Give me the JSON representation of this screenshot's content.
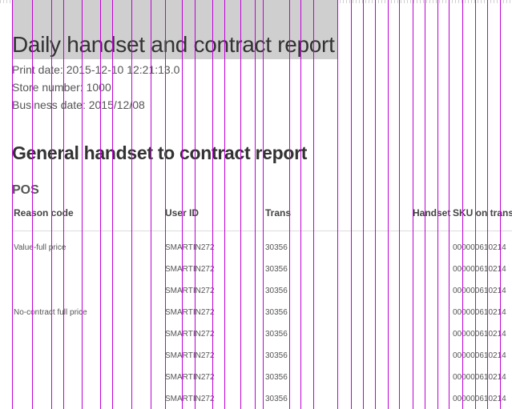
{
  "report": {
    "title": "Daily handset and contract report",
    "print_date": "Print date: 2015-12-10 12:21:13.0",
    "store_number": "Store number: 1000",
    "business_date": "Business date: 2015/12/08"
  },
  "section": {
    "title": "General handset to contract report",
    "subtitle": "POS"
  },
  "table": {
    "columns": [
      "Reason code",
      "User ID",
      "Trans",
      "Handset",
      "SKU on trans"
    ],
    "rows": [
      {
        "reason": "Value-full price",
        "user": "SMARTIN272",
        "trans": "30356",
        "sku": "000000610214"
      },
      {
        "reason": "",
        "user": "SMARTIN272",
        "trans": "30356",
        "sku": "000000610214"
      },
      {
        "reason": "",
        "user": "SMARTIN272",
        "trans": "30356",
        "sku": "000000610214"
      },
      {
        "reason": "No-contract full price",
        "user": "SMARTIN272",
        "trans": "30356",
        "sku": "000000610214"
      },
      {
        "reason": "",
        "user": "SMARTIN272",
        "trans": "30356",
        "sku": "000000610214"
      },
      {
        "reason": "",
        "user": "SMARTIN272",
        "trans": "30356",
        "sku": "000000610214"
      },
      {
        "reason": "",
        "user": "SMARTIN272",
        "trans": "30356",
        "sku": "000000610214"
      },
      {
        "reason": "",
        "user": "SMARTIN272",
        "trans": "30356",
        "sku": "000000610214"
      }
    ]
  },
  "colors": {
    "title_band": "#cfcfcf",
    "guide_lines": "#c000d8"
  }
}
